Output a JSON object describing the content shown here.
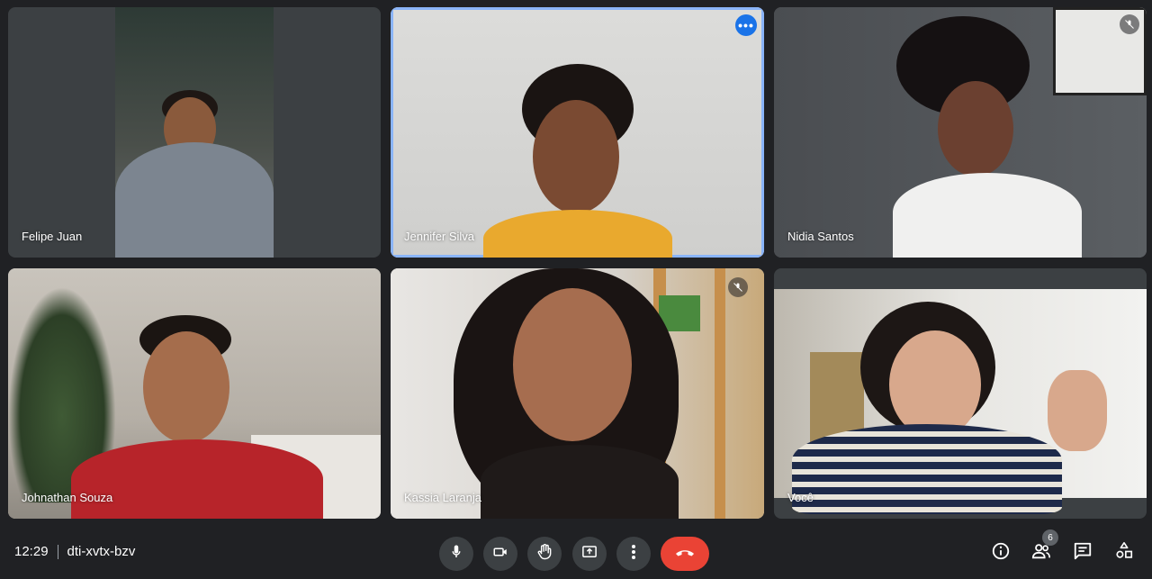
{
  "meeting": {
    "time": "12:29",
    "code": "dti-xvtx-bzv"
  },
  "participants": [
    {
      "name": "Felipe Juan",
      "muted": false,
      "active": false
    },
    {
      "name": "Jennifer Silva",
      "muted": false,
      "active": true
    },
    {
      "name": "Nidia Santos",
      "muted": true,
      "active": false
    },
    {
      "name": "Johnathan Souza",
      "muted": false,
      "active": false
    },
    {
      "name": "Kassia Laranja",
      "muted": true,
      "active": false
    },
    {
      "name": "Você",
      "muted": false,
      "active": false
    }
  ],
  "people_count": "6",
  "controls": [
    {
      "icon": "microphone-icon"
    },
    {
      "icon": "camera-icon"
    },
    {
      "icon": "raise-hand-icon"
    },
    {
      "icon": "present-screen-icon"
    },
    {
      "icon": "more-options-icon"
    },
    {
      "icon": "end-call-icon"
    }
  ],
  "right_controls": [
    {
      "icon": "info-icon"
    },
    {
      "icon": "people-icon"
    },
    {
      "icon": "chat-icon"
    },
    {
      "icon": "activities-icon"
    }
  ],
  "colors": {
    "background": "#202124",
    "tile": "#3c4043",
    "active_border": "#8ab4f8",
    "end_call": "#ea4335",
    "accent": "#1a73e8"
  }
}
